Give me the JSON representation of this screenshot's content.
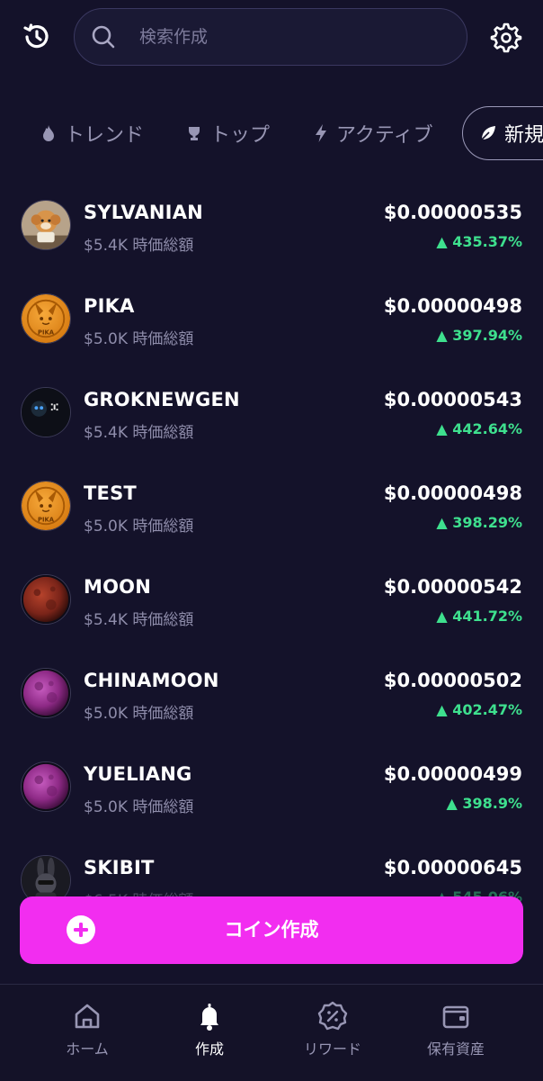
{
  "search": {
    "placeholder": "検索作成"
  },
  "tabs": [
    {
      "label": "トレンド",
      "icon": "flame-icon"
    },
    {
      "label": "トップ",
      "icon": "trophy-icon"
    },
    {
      "label": "アクティブ",
      "icon": "lightning-icon"
    },
    {
      "label": "新規",
      "icon": "leaf-icon",
      "active": true
    }
  ],
  "coins": [
    {
      "name": "SYLVANIAN",
      "cap": "$5.4K 時価総額",
      "price": "$0.00000535",
      "change": "435.37%"
    },
    {
      "name": "PIKA",
      "cap": "$5.0K 時価総額",
      "price": "$0.00000498",
      "change": "397.94%"
    },
    {
      "name": "GROKNEWGEN",
      "cap": "$5.4K 時価総額",
      "price": "$0.00000543",
      "change": "442.64%"
    },
    {
      "name": "TEST",
      "cap": "$5.0K 時価総額",
      "price": "$0.00000498",
      "change": "398.29%"
    },
    {
      "name": "MOON",
      "cap": "$5.4K 時価総額",
      "price": "$0.00000542",
      "change": "441.72%"
    },
    {
      "name": "CHINAMOON",
      "cap": "$5.0K 時価総額",
      "price": "$0.00000502",
      "change": "402.47%"
    },
    {
      "name": "YUELIANG",
      "cap": "$5.0K 時価総額",
      "price": "$0.00000499",
      "change": "398.9%"
    },
    {
      "name": "SKIBIT",
      "cap": "$6.5K 時価総額",
      "price": "$0.00000645",
      "change": "545.06%"
    }
  ],
  "create_button": {
    "label": "コイン作成"
  },
  "nav": {
    "home": "ホーム",
    "create": "作成",
    "rewards": "リワード",
    "holdings": "保有資産"
  },
  "colors": {
    "accent": "#f22df0",
    "positive": "#3ee08e",
    "background": "#14122a"
  }
}
